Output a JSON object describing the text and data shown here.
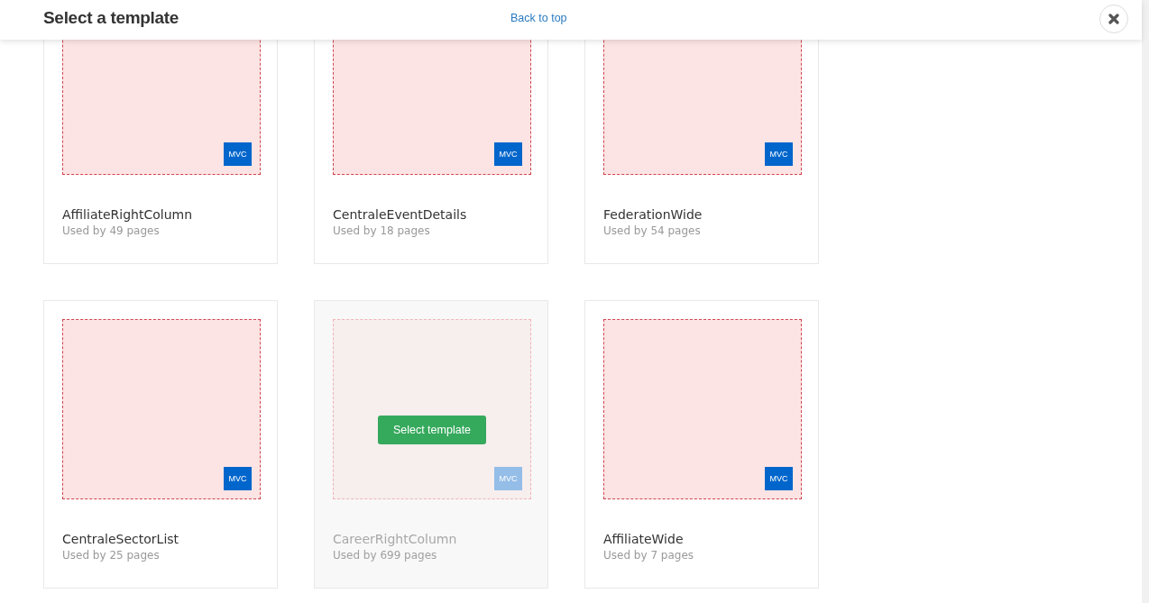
{
  "header": {
    "title": "Select a template",
    "link": "Back to top"
  },
  "templates": [
    {
      "name": "AffiliateRightColumn",
      "usage": "Used by 49 pages",
      "badge": "MVC",
      "hovered": false
    },
    {
      "name": "CentraleEventDetails",
      "usage": "Used by 18 pages",
      "badge": "MVC",
      "hovered": false
    },
    {
      "name": "FederationWide",
      "usage": "Used by 54 pages",
      "badge": "MVC",
      "hovered": false
    },
    {
      "name": "CentraleSectorList",
      "usage": "Used by 25 pages",
      "badge": "MVC",
      "hovered": false
    },
    {
      "name": "CareerRightColumn",
      "usage": "Used by 699 pages",
      "badge": "MVC",
      "hovered": true,
      "action": "Select template"
    },
    {
      "name": "AffiliateWide",
      "usage": "Used by 7 pages",
      "badge": "MVC",
      "hovered": false
    }
  ]
}
